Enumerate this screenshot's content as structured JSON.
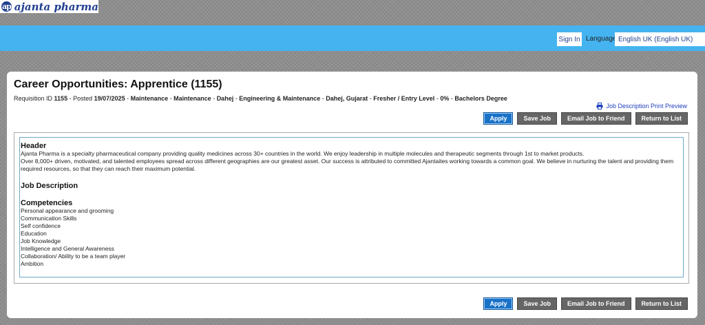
{
  "brand": {
    "logo_mark": "ap",
    "logo_text": "ajanta pharma"
  },
  "header": {
    "sign_in_label": "Sign In",
    "language_label": "Language",
    "language_value": "English UK (English UK)"
  },
  "job": {
    "title": "Career Opportunities: Apprentice (1155)",
    "meta": {
      "req_label": "Requisition ID",
      "req_id": "1155",
      "posted_label": " - Posted ",
      "posted_date": "19/07/2025",
      "sep": " - ",
      "tags": [
        "Maintenance",
        "Maintenance",
        "Dahej",
        "Engineering & Maintenance",
        "Dahej, Gujarat",
        "Fresher / Entry Level",
        "0%",
        "Bachelors Degree"
      ]
    },
    "print_preview_label": "Job Description Print Preview"
  },
  "actions": {
    "apply": "Apply",
    "save_job": "Save Job",
    "email_friend": "Email Job to Friend",
    "return_list": "Return to List"
  },
  "content": {
    "header_heading": "Header",
    "header_p1": "Ajanta Pharma is a specialty pharmaceutical company providing quality medicines across 30+ countries in the world.  We enjoy leadership in multiple molecules and therapeutic segments through 1st to market products.",
    "header_p2": "Over 8,000+ driven, motivated, and talented employees spread across different geographies are our greatest asset. Our success is attributed to committed Ajantaites working towards a common goal. We believe in nurturing the talent and providing them required resources, so that they can reach their maximum potential.",
    "job_description_heading": "Job Description",
    "competencies_heading": "Competencies",
    "competencies": [
      "Personal appearance and grooming",
      "Communication Skills",
      "Self confidence",
      "Education",
      "Job Knowledge",
      "Intelligence and General Awareness",
      "Collaboration/ Ability to be a team player",
      "Ambition"
    ]
  },
  "colors": {
    "header_band": "#45b3f0",
    "apply_button": "#1a72c7",
    "neutral_button": "#666666",
    "link": "#1f3fbf"
  }
}
